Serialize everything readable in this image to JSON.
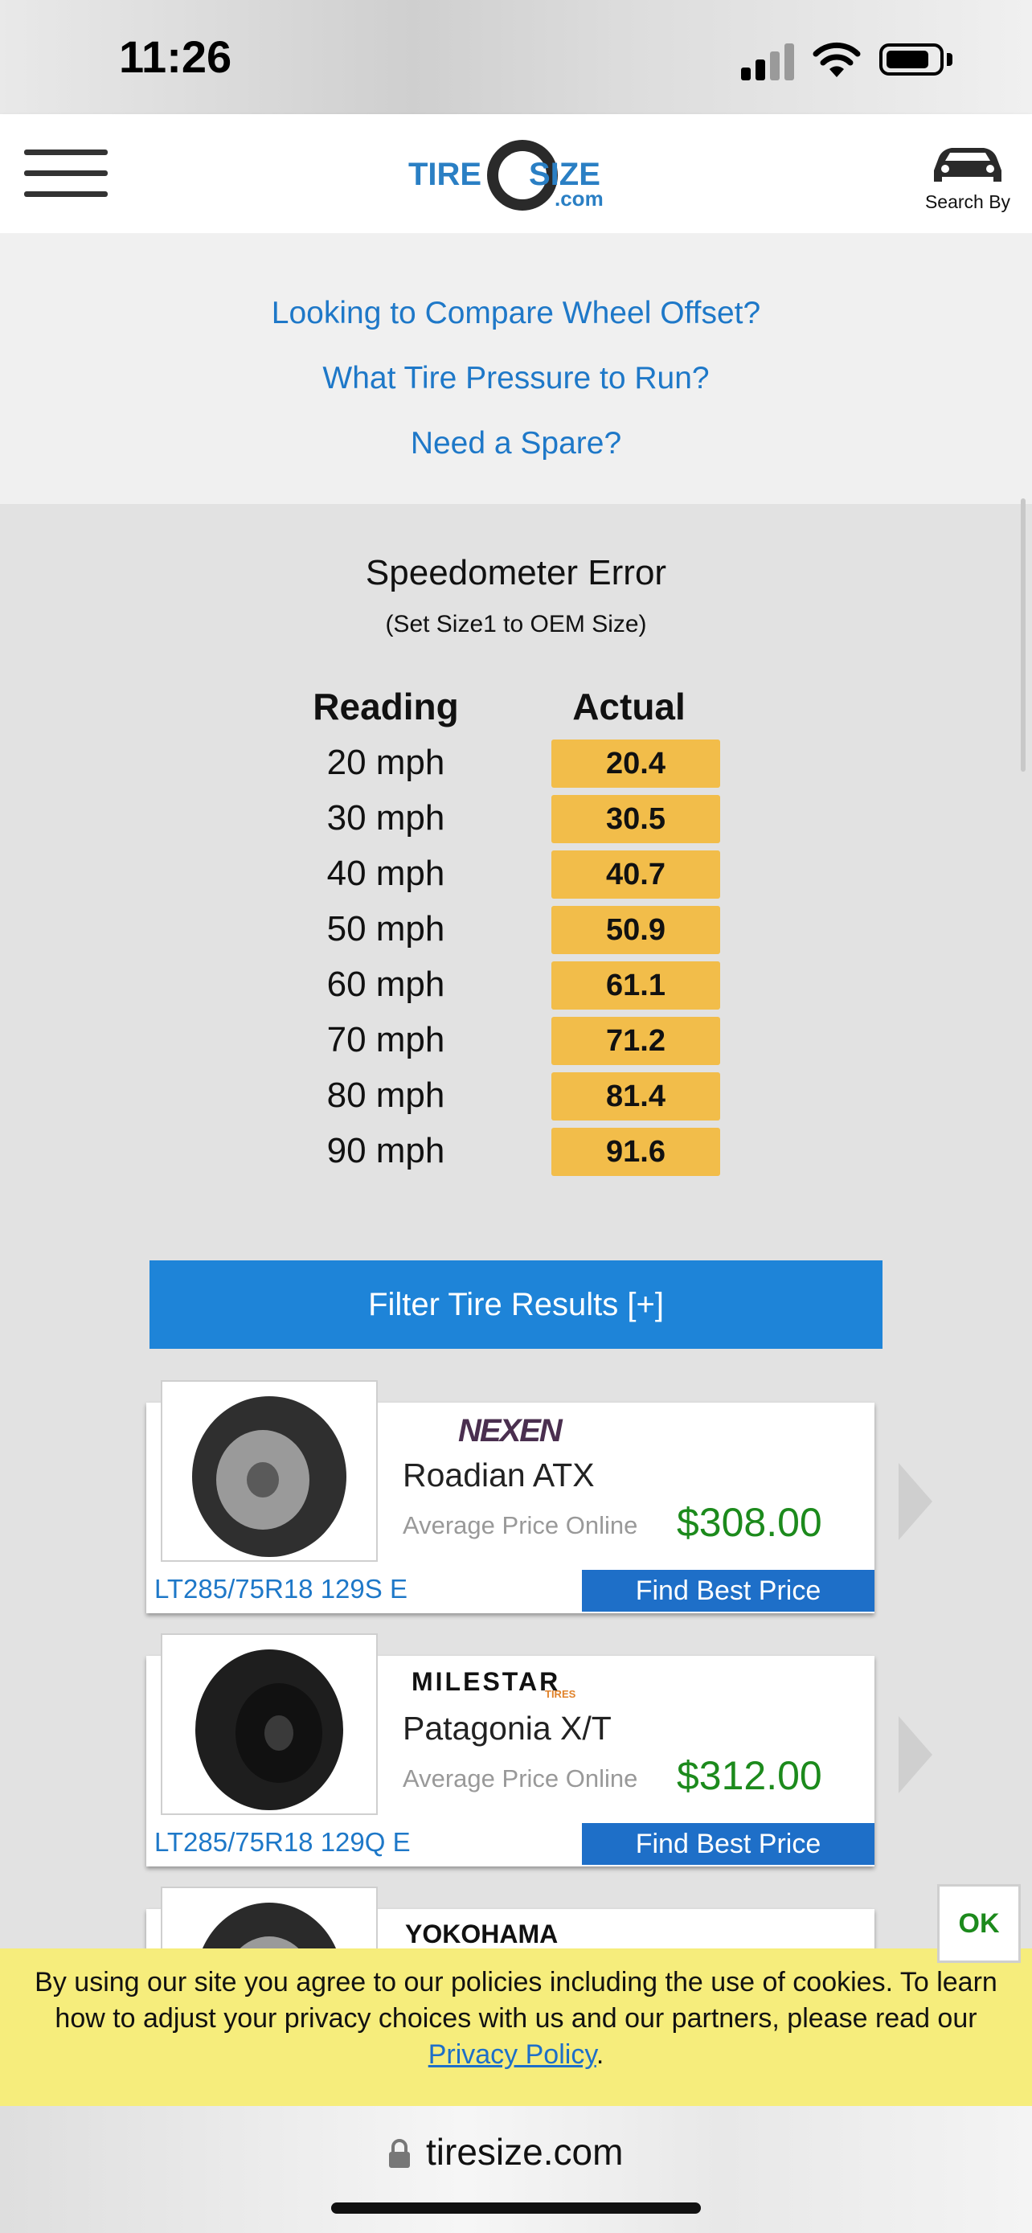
{
  "status_bar": {
    "time": "11:26"
  },
  "header": {
    "logo_text_1": "TIRE",
    "logo_text_2": "SIZE",
    "logo_text_3": ".com",
    "search_by_label": "Search By"
  },
  "links": [
    "Looking to Compare Wheel Offset?",
    "What Tire Pressure to Run?",
    "Need a Spare?"
  ],
  "speedometer": {
    "title": "Speedometer Error",
    "subtitle": "(Set Size1 to OEM Size)",
    "col_reading": "Reading",
    "col_actual": "Actual",
    "rows": [
      {
        "reading": "20 mph",
        "actual": "20.4"
      },
      {
        "reading": "30 mph",
        "actual": "30.5"
      },
      {
        "reading": "40 mph",
        "actual": "40.7"
      },
      {
        "reading": "50 mph",
        "actual": "50.9"
      },
      {
        "reading": "60 mph",
        "actual": "61.1"
      },
      {
        "reading": "70 mph",
        "actual": "71.2"
      },
      {
        "reading": "80 mph",
        "actual": "81.4"
      },
      {
        "reading": "90 mph",
        "actual": "91.6"
      }
    ],
    "actual_color": "#f2bd4a"
  },
  "filter": {
    "label": "Filter Tire Results [+]"
  },
  "tires": [
    {
      "brand": "NEXEN",
      "model": "Roadian ATX",
      "avg_label": "Average Price Online",
      "price": "$308.00",
      "size": "LT285/75R18 129S E",
      "button": "Find Best Price"
    },
    {
      "brand": "MILESTAR",
      "brand_sub": "TIRES",
      "model": "Patagonia X/T",
      "avg_label": "Average Price Online",
      "price": "$312.00",
      "size": "LT285/75R18 129Q E",
      "button": "Find Best Price"
    },
    {
      "brand": "YOKOHAMA"
    }
  ],
  "cookie": {
    "text": "By using our site you agree to our policies including the use of cookies. To learn how to adjust your privacy choices with us and our partners, please read our",
    "link": "Privacy Policy",
    "after": ".",
    "ok": "OK"
  },
  "browser": {
    "url": "tiresize.com"
  },
  "colors": {
    "link": "#1e78c8",
    "button": "#1e84d8",
    "price": "#1c8a1c",
    "cookie_bg": "#f6ed7c"
  }
}
